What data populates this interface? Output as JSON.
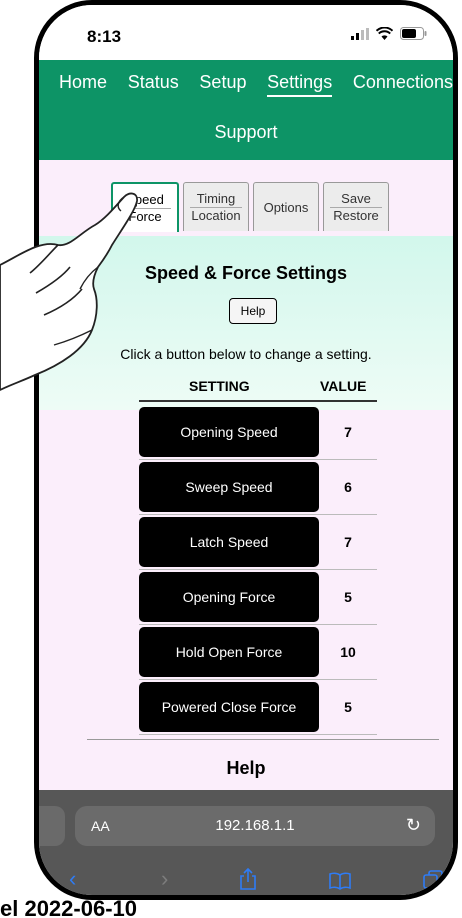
{
  "status_bar": {
    "time": "8:13"
  },
  "nav": {
    "items": [
      "Home",
      "Status",
      "Setup",
      "Settings",
      "Connections"
    ],
    "second_row": "Support",
    "active": "Settings"
  },
  "tabs": [
    {
      "line1": "Speed",
      "line2": "Force",
      "active": true
    },
    {
      "line1": "Timing",
      "line2": "Location",
      "active": false
    },
    {
      "line1": "Options",
      "line2": "",
      "active": false
    },
    {
      "line1": "Save",
      "line2": "Restore",
      "active": false
    }
  ],
  "main": {
    "title": "Speed & Force Settings",
    "help_button": "Help",
    "instruction": "Click a button below to change a setting.",
    "col_setting": "SETTING",
    "col_value": "VALUE",
    "rows": [
      {
        "setting": "Opening Speed",
        "value": "7"
      },
      {
        "setting": "Sweep Speed",
        "value": "6"
      },
      {
        "setting": "Latch Speed",
        "value": "7"
      },
      {
        "setting": "Opening Force",
        "value": "5"
      },
      {
        "setting": "Hold Open Force",
        "value": "10"
      },
      {
        "setting": "Powered Close Force",
        "value": "5"
      }
    ],
    "help_heading": "Help"
  },
  "browser": {
    "text_size": "AA",
    "url": "192.168.1.1"
  },
  "colors": {
    "nav_green": "#0d9466",
    "page_pink": "#fbeefb",
    "link_blue": "#2e7cf6"
  },
  "icons": [
    "cellular-icon",
    "wifi-icon",
    "battery-icon",
    "reload-icon",
    "back-icon",
    "forward-icon",
    "share-icon",
    "bookmarks-icon",
    "tabs-icon",
    "pointing-hand-icon"
  ],
  "bottom_caption": "el 2022-06-10"
}
